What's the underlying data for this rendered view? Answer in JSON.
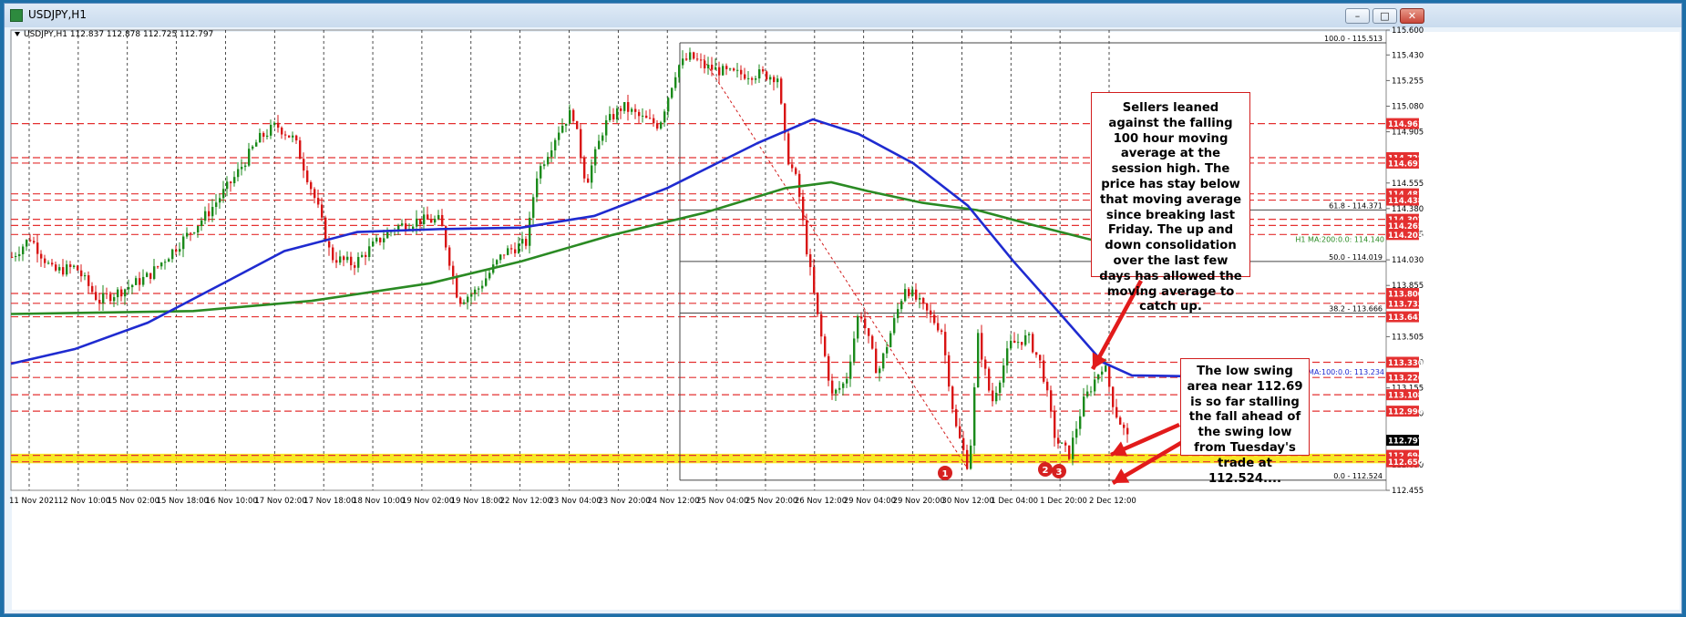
{
  "window": {
    "title": "USDJPY,H1"
  },
  "window_buttons": {
    "minimize": "–",
    "maximize": "□",
    "close": "✕"
  },
  "ohlc_header": "USDJPY,H1  112.837 112.878 112.725 112.797",
  "annotations": {
    "note1": "Sellers leaned against the falling 100 hour moving average at the session high. The price has stay below that moving average since breaking last Friday.  The up and down consolidation over the last few days has allowed the moving average to catch up.",
    "note2": "The low swing area near 112.69 is so far stalling the fall ahead of the swing low from Tuesday's trade at 112.524....",
    "markers": [
      "1",
      "2",
      "3"
    ]
  },
  "colors": {
    "ma100": "#1f2bd0",
    "ma200": "#2a8a23",
    "bull": "#1b8a1b",
    "bear": "#d81414",
    "hline": "#e43030",
    "support": "#f6e400",
    "note_border": "#d21d1d"
  },
  "chart_data": {
    "type": "line",
    "symbol": "USDJPY",
    "timeframe": "H1",
    "last_price": 112.797,
    "y_range": [
      112.455,
      115.6
    ],
    "y_ticks": [
      "115.600",
      "115.430",
      "115.255",
      "115.080",
      "114.905",
      "114.555",
      "114.380",
      "114.205",
      "114.030",
      "113.855",
      "113.505",
      "113.330",
      "113.155",
      "112.980",
      "112.630",
      "112.455"
    ],
    "x_ticks": [
      "11 Nov 2021",
      "12 Nov 10:00",
      "15 Nov 02:00",
      "15 Nov 18:00",
      "16 Nov 10:00",
      "17 Nov 02:00",
      "17 Nov 18:00",
      "18 Nov 10:00",
      "19 Nov 02:00",
      "19 Nov 18:00",
      "22 Nov 12:00",
      "23 Nov 04:00",
      "23 Nov 20:00",
      "24 Nov 12:00",
      "25 Nov 04:00",
      "25 Nov 20:00",
      "26 Nov 12:00",
      "29 Nov 04:00",
      "29 Nov 20:00",
      "30 Nov 12:00",
      "1 Dec 04:00",
      "1 Dec 20:00",
      "2 Dec 12:00"
    ],
    "levels": [
      {
        "label": "114.961",
        "value": 114.961
      },
      {
        "label": "114.728",
        "value": 114.728
      },
      {
        "label": "114.691",
        "value": 114.691
      },
      {
        "label": "114.481",
        "value": 114.481
      },
      {
        "label": "114.438",
        "value": 114.438
      },
      {
        "label": "114.307",
        "value": 114.307
      },
      {
        "label": "114.265",
        "value": 114.265
      },
      {
        "label": "114.203",
        "value": 114.203
      },
      {
        "label": "113.800",
        "value": 113.8
      },
      {
        "label": "113.733",
        "value": 113.733
      },
      {
        "label": "113.641",
        "value": 113.641
      },
      {
        "label": "113.330",
        "value": 113.33
      },
      {
        "label": "113.226",
        "value": 113.226
      },
      {
        "label": "113.108",
        "value": 113.108
      },
      {
        "label": "112.996",
        "value": 112.996
      },
      {
        "label": "112.694",
        "value": 112.694
      },
      {
        "label": "112.650",
        "value": 112.65
      }
    ],
    "fibonacci": [
      {
        "label": "100.0 - 115.513",
        "value": 115.513
      },
      {
        "label": "61.8 - 114.371",
        "value": 114.371
      },
      {
        "label": "50.0 - 114.019",
        "value": 114.019
      },
      {
        "label": "38.2 - 113.666",
        "value": 113.666
      },
      {
        "label": "0.0 - 112.524",
        "value": 112.524
      }
    ],
    "series": [
      {
        "name": "H1 MA:200:0.0: 114.140",
        "label": "H1 MA:200:0.0: 114.140",
        "value": 114.14,
        "points": [
          [
            0,
            113.66
          ],
          [
            100,
            113.67
          ],
          [
            200,
            113.68
          ],
          [
            330,
            113.75
          ],
          [
            460,
            113.87
          ],
          [
            560,
            114.02
          ],
          [
            660,
            114.2
          ],
          [
            760,
            114.35
          ],
          [
            850,
            114.52
          ],
          [
            900,
            114.56
          ],
          [
            940,
            114.5
          ],
          [
            1000,
            114.42
          ],
          [
            1060,
            114.37
          ],
          [
            1120,
            114.27
          ],
          [
            1190,
            114.16
          ],
          [
            1298,
            114.14
          ]
        ]
      },
      {
        "name": "H1 MA:100:0.0: 113.234",
        "label": "H1 MA:100:0.0: 113.234",
        "value": 113.234,
        "points": [
          [
            0,
            113.32
          ],
          [
            70,
            113.42
          ],
          [
            150,
            113.6
          ],
          [
            230,
            113.86
          ],
          [
            300,
            114.09
          ],
          [
            380,
            114.22
          ],
          [
            470,
            114.24
          ],
          [
            560,
            114.25
          ],
          [
            640,
            114.33
          ],
          [
            720,
            114.52
          ],
          [
            820,
            114.83
          ],
          [
            880,
            114.99
          ],
          [
            930,
            114.89
          ],
          [
            990,
            114.69
          ],
          [
            1050,
            114.4
          ],
          [
            1100,
            114.02
          ],
          [
            1150,
            113.67
          ],
          [
            1198,
            113.33
          ],
          [
            1230,
            113.24
          ],
          [
            1298,
            113.234
          ]
        ]
      }
    ],
    "price_path": [
      [
        0,
        114.05
      ],
      [
        20,
        114.18
      ],
      [
        45,
        113.95
      ],
      [
        70,
        113.98
      ],
      [
        95,
        113.75
      ],
      [
        120,
        113.82
      ],
      [
        150,
        113.92
      ],
      [
        185,
        114.15
      ],
      [
        215,
        114.35
      ],
      [
        245,
        114.6
      ],
      [
        270,
        114.85
      ],
      [
        290,
        114.95
      ],
      [
        310,
        114.85
      ],
      [
        335,
        114.4
      ],
      [
        350,
        114.05
      ],
      [
        375,
        114.0
      ],
      [
        400,
        114.15
      ],
      [
        420,
        114.25
      ],
      [
        445,
        114.3
      ],
      [
        470,
        114.3
      ],
      [
        490,
        113.75
      ],
      [
        510,
        113.82
      ],
      [
        540,
        114.08
      ],
      [
        565,
        114.15
      ],
      [
        575,
        114.6
      ],
      [
        600,
        114.92
      ],
      [
        615,
        115.05
      ],
      [
        630,
        114.55
      ],
      [
        650,
        114.95
      ],
      [
        670,
        115.08
      ],
      [
        690,
        115.0
      ],
      [
        710,
        114.95
      ],
      [
        730,
        115.35
      ],
      [
        745,
        115.42
      ],
      [
        760,
        115.35
      ],
      [
        790,
        115.3
      ],
      [
        820,
        115.3
      ],
      [
        840,
        115.28
      ],
      [
        850,
        114.75
      ],
      [
        862,
        114.55
      ],
      [
        872,
        114.1
      ],
      [
        885,
        113.6
      ],
      [
        900,
        113.1
      ],
      [
        915,
        113.2
      ],
      [
        930,
        113.7
      ],
      [
        950,
        113.25
      ],
      [
        965,
        113.55
      ],
      [
        980,
        113.85
      ],
      [
        1000,
        113.7
      ],
      [
        1020,
        113.55
      ],
      [
        1035,
        112.9
      ],
      [
        1050,
        112.6
      ],
      [
        1060,
        113.5
      ],
      [
        1075,
        113.05
      ],
      [
        1095,
        113.45
      ],
      [
        1115,
        113.5
      ],
      [
        1130,
        113.3
      ],
      [
        1145,
        112.8
      ],
      [
        1160,
        112.7
      ],
      [
        1175,
        113.05
      ],
      [
        1198,
        113.33
      ],
      [
        1210,
        113.0
      ],
      [
        1225,
        112.8
      ]
    ],
    "swing_dashed_line": [
      [
        760,
        115.4
      ],
      [
        1050,
        112.6
      ]
    ]
  }
}
